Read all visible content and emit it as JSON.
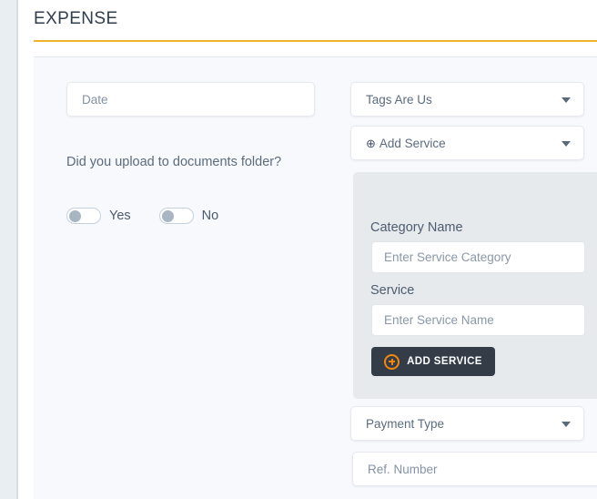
{
  "header": {
    "title": "EXPENSE",
    "rule_color": "#f0b429"
  },
  "form": {
    "date": {
      "placeholder": "Date"
    },
    "upload_question": {
      "label": "Did you upload to documents folder?",
      "options": [
        {
          "label": "Yes",
          "state": "off"
        },
        {
          "label": "No",
          "state": "off"
        }
      ]
    },
    "tags": {
      "selected": "Tags Are Us",
      "icon": "chevron-down-icon"
    },
    "add_service_select": {
      "icon": "plus-circle-icon",
      "selected": "Add Service",
      "caret": "chevron-down-icon"
    },
    "service_panel": {
      "category_label": "Category Name",
      "category_placeholder": "Enter Service Category",
      "service_label": "Service",
      "service_placeholder": "Enter Service Name",
      "button_label": "ADD SERVICE",
      "button_icon": "plus-circle-icon",
      "button_bg": "#333c47",
      "button_icon_color": "#f2870d",
      "panel_bg": "#e7eaed"
    },
    "payment_type": {
      "selected": "Payment Type",
      "icon": "chevron-down-icon"
    },
    "ref_number": {
      "placeholder": "Ref. Number"
    }
  }
}
